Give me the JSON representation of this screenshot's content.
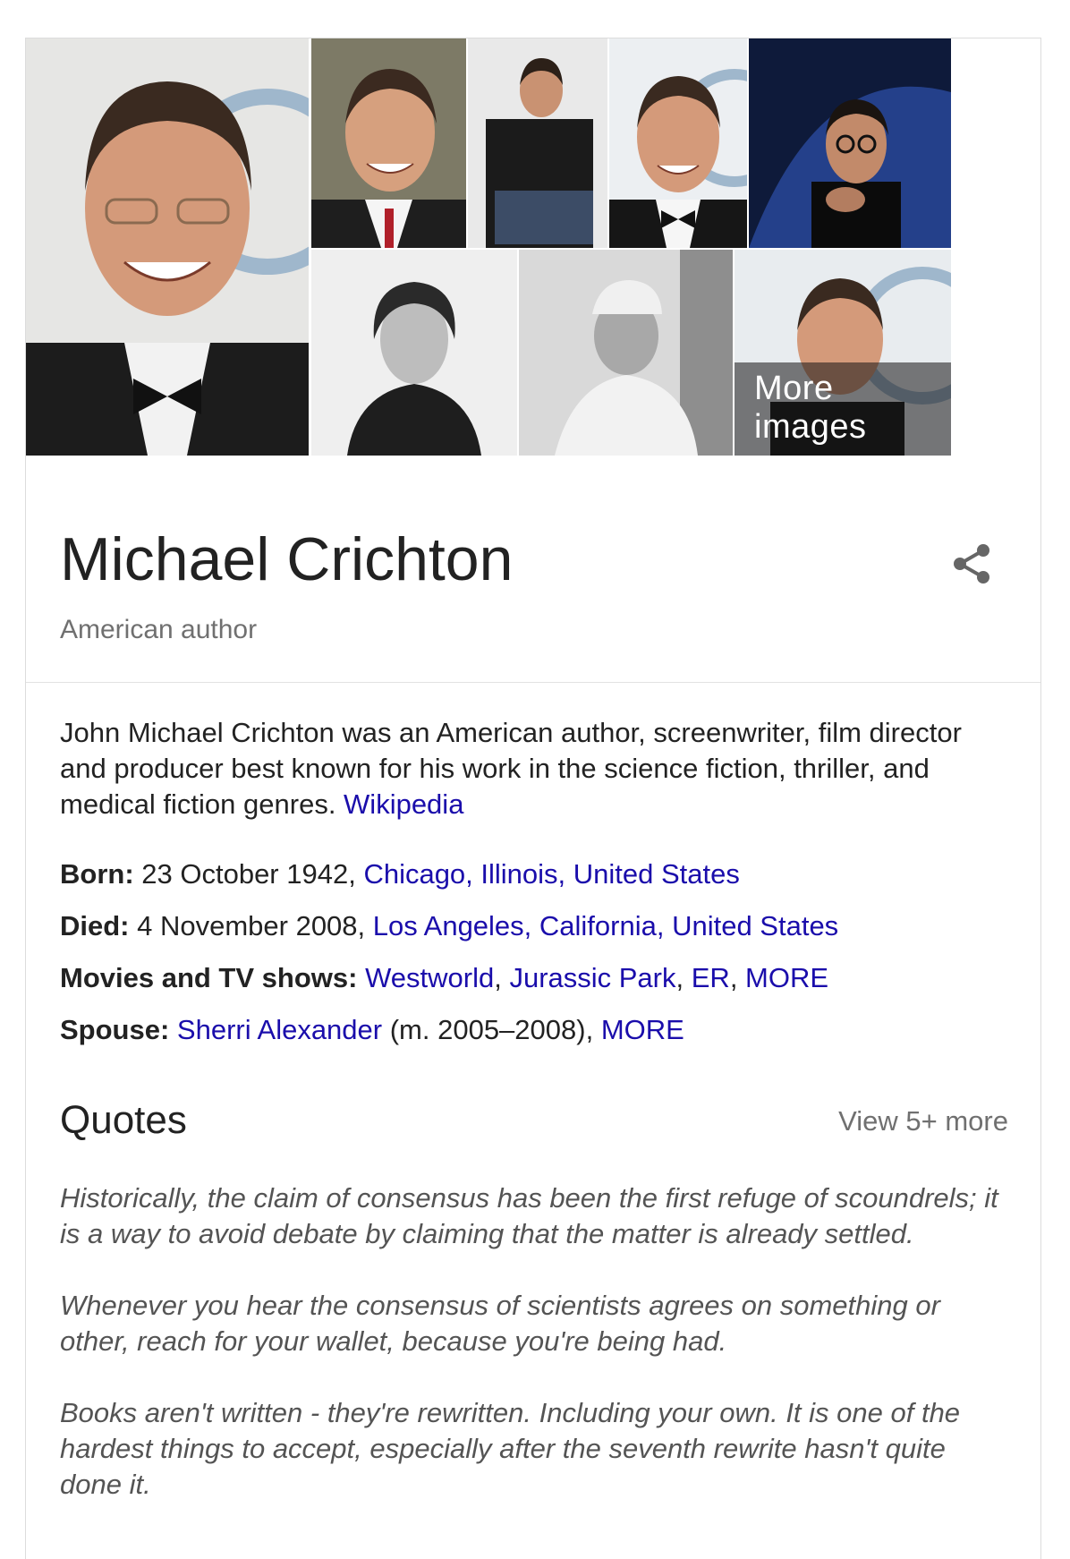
{
  "gallery": {
    "more_images_label": "More images",
    "photo_alts": [
      "Michael Crichton portrait",
      "Michael Crichton smiling",
      "Michael Crichton seated",
      "Michael Crichton at event",
      "Michael Crichton dark portrait",
      "Michael Crichton young",
      "Michael Crichton in surgical cap",
      "Michael Crichton at PGA event"
    ]
  },
  "header": {
    "title": "Michael Crichton",
    "subtitle": "American author"
  },
  "description": {
    "text": "John Michael Crichton was an American author, screenwriter, film director and producer best known for his work in the science fiction, thriller, and medical fiction genres. ",
    "source_link": "Wikipedia"
  },
  "facts": {
    "born": {
      "label": "Born:",
      "value": " 23 October 1942, ",
      "link": "Chicago, Illinois, United States"
    },
    "died": {
      "label": "Died:",
      "value": " 4 November 2008, ",
      "link": "Los Angeles, California, United States"
    },
    "movies": {
      "label": "Movies and TV shows:",
      "links": [
        "Westworld",
        "Jurassic Park",
        "ER",
        "MORE"
      ],
      "sep": ", "
    },
    "spouse": {
      "label": "Spouse:",
      "link": "Sherri Alexander",
      "extra": " (m. 2005–2008), ",
      "more": "MORE"
    }
  },
  "quotes": {
    "title": "Quotes",
    "view_more": "View 5+ more",
    "items": [
      "Historically, the claim of consensus has been the first refuge of scoundrels; it is a way to avoid debate by claiming that the matter is already settled.",
      "Whenever you hear the consensus of scientists agrees on something or other, reach for your wallet, because you're being had.",
      "Books aren't written - they're rewritten. Including your own. It is one of the hardest things to accept, especially after the seventh rewrite hasn't quite done it."
    ]
  },
  "colors": {
    "link": "#1a0dab",
    "muted": "#707070",
    "quote": "#545454"
  }
}
